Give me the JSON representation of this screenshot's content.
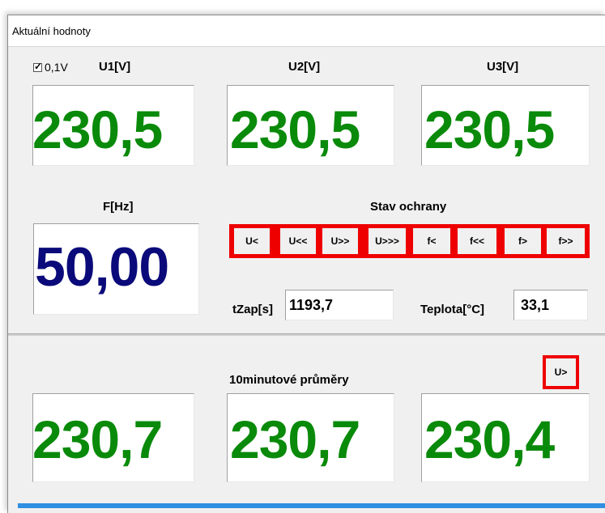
{
  "window": {
    "title": "Aktuální hodnoty"
  },
  "top": {
    "checkbox_label": "0,1V",
    "checked": true,
    "u1_label": "U1[V]",
    "u2_label": "U2[V]",
    "u3_label": "U3[V]",
    "u1_value": "230,5",
    "u2_value": "230,5",
    "u3_value": "230,5"
  },
  "frequency": {
    "label": "F[Hz]",
    "value": "50,00"
  },
  "protection": {
    "title": "Stav ochrany",
    "buttons": [
      "U<",
      "U<<",
      "U>>",
      "U>>>",
      "f<",
      "f<<",
      "f>",
      "f>>"
    ],
    "tzap_label": "tZap[s]",
    "tzap_value": "1193,7",
    "temp_label": "Teplota[°C]",
    "temp_value": "33,1"
  },
  "averages": {
    "title": "10minutové průměry",
    "indicator": "U>",
    "values": [
      "230,7",
      "230,7",
      "230,4"
    ]
  },
  "colors": {
    "green": "#0a8a0a",
    "navy": "#0a0a7a",
    "alarm_red": "#ef0000",
    "accent_blue": "#2f8fe0"
  }
}
